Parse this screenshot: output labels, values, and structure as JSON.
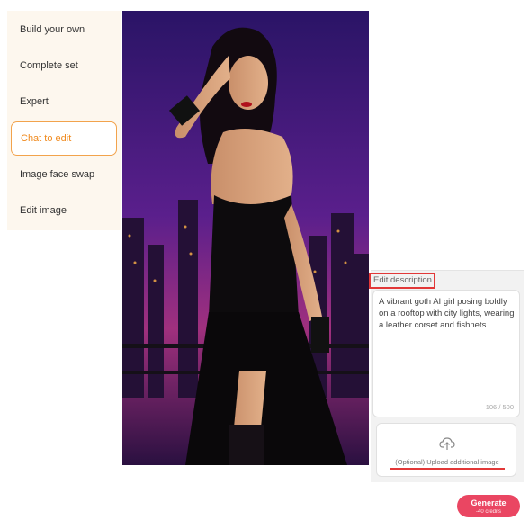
{
  "sidebar": {
    "items": [
      {
        "label": "Build your own"
      },
      {
        "label": "Complete set"
      },
      {
        "label": "Expert"
      },
      {
        "label": "Chat to edit"
      },
      {
        "label": "Image face swap"
      },
      {
        "label": "Edit image"
      }
    ],
    "active_index": 3
  },
  "editor": {
    "section_label": "Edit description",
    "description": "A vibrant goth AI girl posing boldly on a rooftop with city lights, wearing a leather corset and fishnets.",
    "char_count": "106 / 500",
    "upload_label": "(Optional) Upload additional image"
  },
  "generate": {
    "label": "Generate",
    "credits": "-40 credits"
  },
  "colors": {
    "accent_orange": "#f08a1e",
    "highlight_red": "#e23838",
    "generate_pink": "#ea4662",
    "sky_purple": "#3a1a78"
  },
  "icons": {
    "upload": "cloud-upload-icon"
  }
}
